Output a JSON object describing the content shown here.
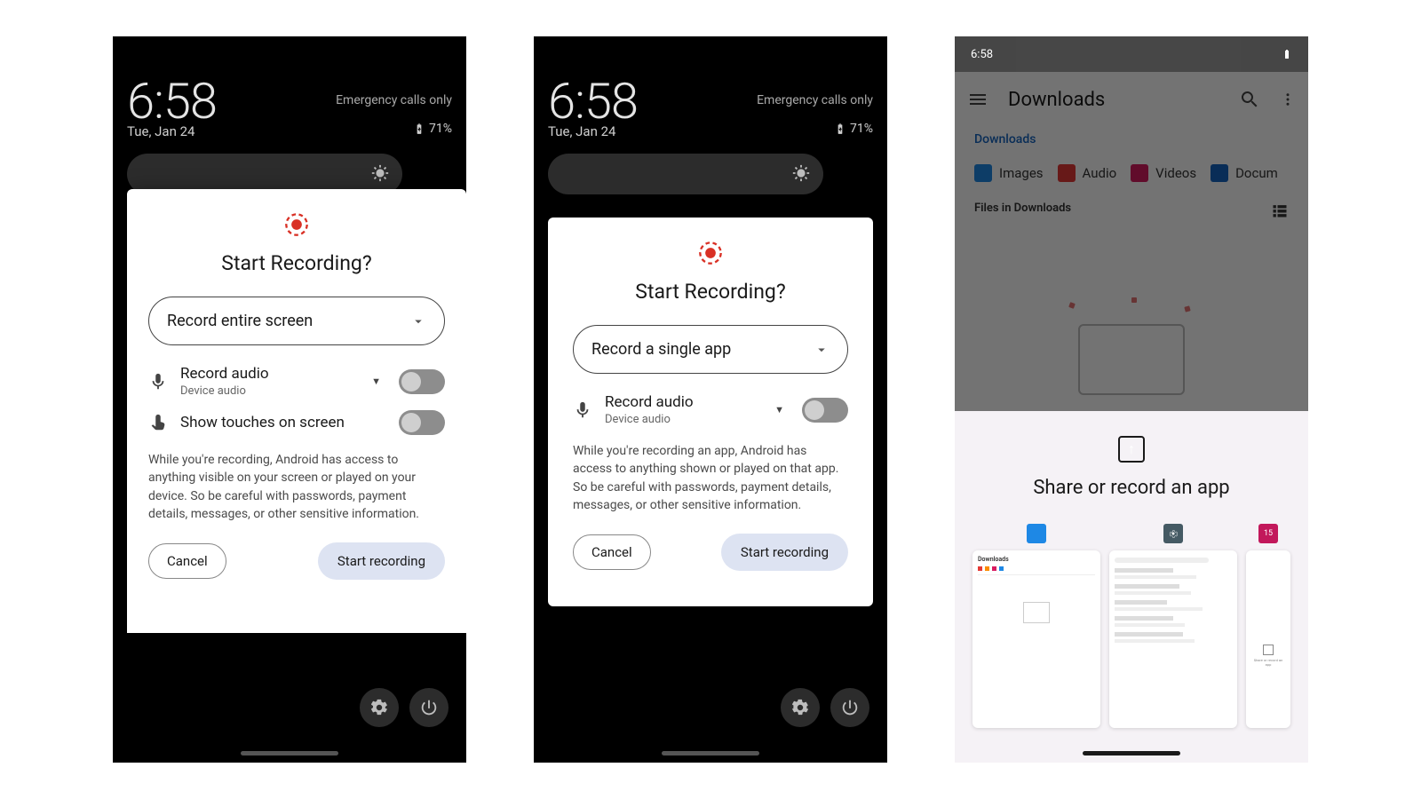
{
  "status": {
    "time": "6:58",
    "date": "Tue, Jan 24",
    "emergency": "Emergency calls only",
    "battery": "71%"
  },
  "modal1": {
    "title": "Start Recording?",
    "dropdown": "Record entire screen",
    "audio_title": "Record audio",
    "audio_sub": "Device audio",
    "touches": "Show touches on screen",
    "disclaimer": "While you're recording, Android has access to anything visible on your screen or played on your device. So be careful with passwords, payment details, messages, or other sensitive information.",
    "cancel": "Cancel",
    "start": "Start recording"
  },
  "modal2": {
    "title": "Start Recording?",
    "dropdown": "Record a single app",
    "audio_title": "Record audio",
    "audio_sub": "Device audio",
    "disclaimer": "While you're recording an app, Android has access to anything shown or played on that app. So be careful with passwords, payment details, messages, or other sensitive information.",
    "cancel": "Cancel",
    "start": "Start recording"
  },
  "p3": {
    "status_time": "6:58",
    "app_title": "Downloads",
    "breadcrumb": "Downloads",
    "chips": {
      "images": "Images",
      "audio": "Audio",
      "videos": "Videos",
      "docs": "Docum"
    },
    "files_label": "Files in Downloads",
    "sheet_title": "Share or record an app"
  }
}
